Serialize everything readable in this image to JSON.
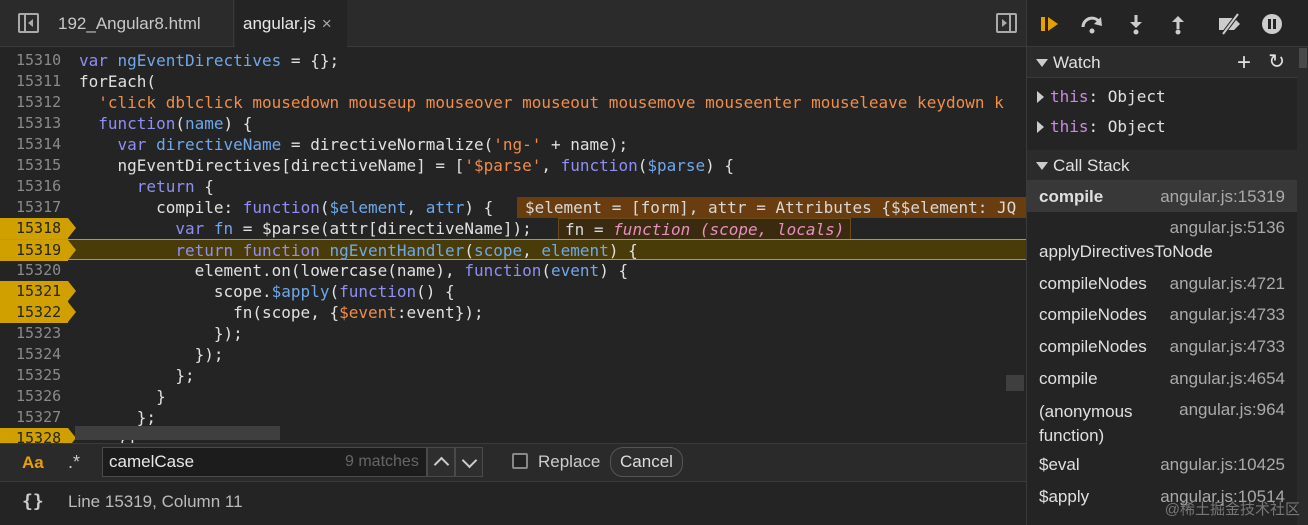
{
  "tabs": [
    {
      "label": "192_Angular8.html"
    },
    {
      "label": "angular.js",
      "close": "×"
    }
  ],
  "code": [
    {
      "n": "15310",
      "t": [
        [
          "kw",
          "var "
        ],
        [
          "vr",
          "ngEventDirectives"
        ],
        [
          "pn",
          " = {};"
        ]
      ]
    },
    {
      "n": "15311",
      "t": [
        [
          "pn",
          "forEach("
        ]
      ]
    },
    {
      "n": "15312",
      "t": [
        [
          "st",
          "  'click dblclick mousedown mouseup mouseover mouseout mousemove mouseenter mouseleave keydown k"
        ]
      ]
    },
    {
      "n": "15313",
      "t": [
        [
          "kw",
          "  function"
        ],
        [
          "pn",
          "("
        ],
        [
          "vr",
          "name"
        ],
        [
          "pn",
          ") {"
        ]
      ]
    },
    {
      "n": "15314",
      "t": [
        [
          "kw",
          "    var "
        ],
        [
          "vr",
          "directiveName"
        ],
        [
          "pn",
          " = directiveNormalize("
        ],
        [
          "st",
          "'ng-'"
        ],
        [
          "pn",
          " + name);"
        ]
      ]
    },
    {
      "n": "15315",
      "t": [
        [
          "pn",
          "    ngEventDirectives[directiveName] = ["
        ],
        [
          "st",
          "'$parse'"
        ],
        [
          "pn",
          ", "
        ],
        [
          "kw",
          "function"
        ],
        [
          "pn",
          "("
        ],
        [
          "vr",
          "$parse"
        ],
        [
          "pn",
          ") {"
        ]
      ]
    },
    {
      "n": "15316",
      "t": [
        [
          "kw",
          "      return "
        ],
        [
          "pn",
          "{"
        ]
      ]
    },
    {
      "n": "15317",
      "t": [
        [
          "pn",
          "        compile: "
        ],
        [
          "kw",
          "function"
        ],
        [
          "pn",
          "("
        ],
        [
          "vr",
          "$element"
        ],
        [
          "pn",
          ", "
        ],
        [
          "vr",
          "attr"
        ],
        [
          "pn",
          ") {"
        ]
      ],
      "inline": "$element = [form], attr = Attributes {$$element: JQ"
    },
    {
      "n": "15318",
      "bp": true,
      "t": [
        [
          "kw",
          "          var "
        ],
        [
          "vr",
          "fn"
        ],
        [
          "pn",
          " = $parse(attr[directiveName]);"
        ]
      ],
      "inline2": [
        "fn = ",
        "function",
        " (scope, locals)"
      ]
    },
    {
      "n": "15319",
      "bp": true,
      "exec": true,
      "t": [
        [
          "kw",
          "          return function "
        ],
        [
          "vr",
          "ngEventHandler"
        ],
        [
          "pn",
          "("
        ],
        [
          "vr",
          "scope"
        ],
        [
          "pn",
          ", "
        ],
        [
          "vr",
          "element"
        ],
        [
          "pn",
          ") {"
        ]
      ]
    },
    {
      "n": "15320",
      "t": [
        [
          "pn",
          "            element.on(lowercase(name), "
        ],
        [
          "kw",
          "function"
        ],
        [
          "pn",
          "("
        ],
        [
          "vr",
          "event"
        ],
        [
          "pn",
          ") {"
        ]
      ]
    },
    {
      "n": "15321",
      "bp": true,
      "t": [
        [
          "pn",
          "              scope."
        ],
        [
          "vr",
          "$apply"
        ],
        [
          "pn",
          "("
        ],
        [
          "kw",
          "function"
        ],
        [
          "pn",
          "() {"
        ]
      ]
    },
    {
      "n": "15322",
      "bp": true,
      "t": [
        [
          "pn",
          "                fn(scope, {"
        ],
        [
          "st",
          "$event"
        ],
        [
          "pn",
          ":event});"
        ]
      ]
    },
    {
      "n": "15323",
      "t": [
        [
          "pn",
          "              });"
        ]
      ]
    },
    {
      "n": "15324",
      "t": [
        [
          "pn",
          "            });"
        ]
      ]
    },
    {
      "n": "15325",
      "t": [
        [
          "pn",
          "          };"
        ]
      ]
    },
    {
      "n": "15326",
      "t": [
        [
          "pn",
          "        }"
        ]
      ]
    },
    {
      "n": "15327",
      "t": [
        [
          "pn",
          "      };"
        ]
      ]
    },
    {
      "n": "15328",
      "bp": true,
      "t": [
        [
          "pn",
          "    }]"
        ]
      ]
    }
  ],
  "search": {
    "case_label": "Aa",
    "regex_label": ".*",
    "value": "camelCase",
    "matches": "9 matches",
    "replace_label": "Replace",
    "cancel_label": "Cancel"
  },
  "status": {
    "icon": "{}",
    "cursor": "Line 15319, Column 11"
  },
  "watch": {
    "title": "Watch",
    "items": [
      {
        "key": "this",
        "val": ": Object"
      },
      {
        "key": "this",
        "val": ": Object"
      }
    ]
  },
  "callstack": {
    "title": "Call Stack",
    "frames": [
      {
        "fn": "compile",
        "loc": "angular.js:15319"
      },
      {
        "fn": "applyDirectivesToNode",
        "loc": "angular.js:5136"
      },
      {
        "fn": "compileNodes",
        "loc": "angular.js:4721"
      },
      {
        "fn": "compileNodes",
        "loc": "angular.js:4733"
      },
      {
        "fn": "compileNodes",
        "loc": "angular.js:4733"
      },
      {
        "fn": "compile",
        "loc": "angular.js:4654"
      },
      {
        "fn": "(anonymous function)",
        "loc": "angular.js:964"
      },
      {
        "fn": "$eval",
        "loc": "angular.js:10425"
      },
      {
        "fn": "$apply",
        "loc": "angular.js:10514"
      }
    ]
  },
  "watermark": "@稀土掘金技术社区",
  "colors": {
    "accent": "#e8a000",
    "keyword": "#8f8ff3",
    "variable": "#6fa8ea",
    "string": "#f08d49"
  }
}
